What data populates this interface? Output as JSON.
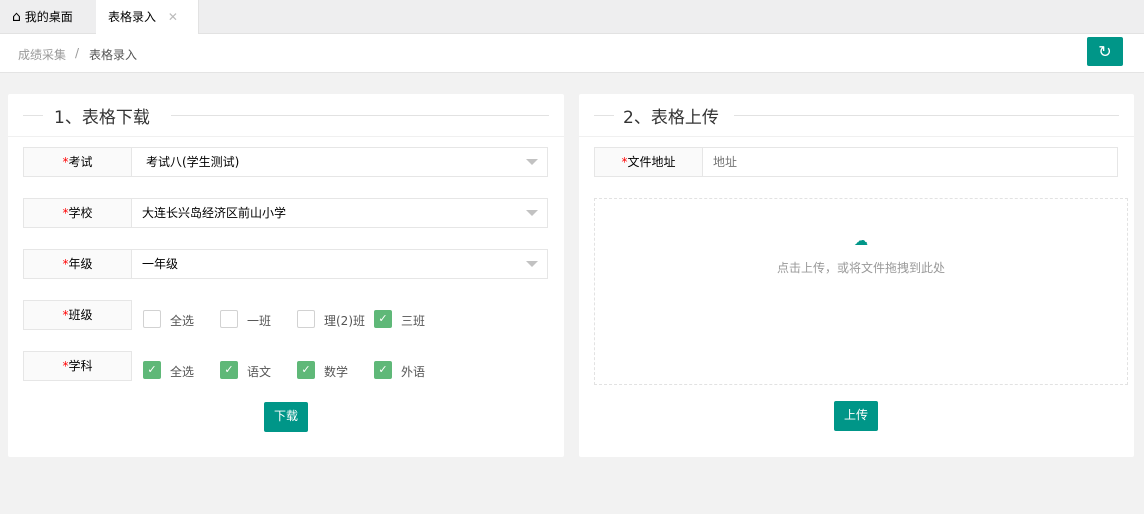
{
  "tabs": [
    {
      "label": "我的桌面",
      "icon": "home-icon"
    },
    {
      "label": "表格录入",
      "close": "✕"
    }
  ],
  "breadcrumb": [
    "成绩采集",
    "/",
    "表格录入"
  ],
  "download": {
    "title": "1、表格下载",
    "exam": {
      "label": "考试",
      "value": "考试八(学生测试)"
    },
    "school": {
      "label": "学校",
      "value": "大连长兴岛经济区前山小学"
    },
    "grade": {
      "label": "年级",
      "value": "一年级"
    },
    "classes": {
      "label": "班级",
      "options": [
        {
          "label": "全选",
          "checked": false
        },
        {
          "label": "一班",
          "checked": false
        },
        {
          "label": "理(2)班",
          "checked": false
        },
        {
          "label": "三班",
          "checked": true
        }
      ]
    },
    "subjects": {
      "label": "学科",
      "options": [
        {
          "label": "全选",
          "checked": true
        },
        {
          "label": "语文",
          "checked": true
        },
        {
          "label": "数学",
          "checked": true
        },
        {
          "label": "外语",
          "checked": true
        }
      ]
    },
    "button": "下载"
  },
  "upload": {
    "title": "2、表格上传",
    "file": {
      "label": "文件地址",
      "placeholder": "地址"
    },
    "hint": "点击上传，或将文件拖拽到此处",
    "button": "上传"
  },
  "required_mark": "*",
  "colors": {
    "accent": "#009688",
    "check": "#5fb878"
  }
}
